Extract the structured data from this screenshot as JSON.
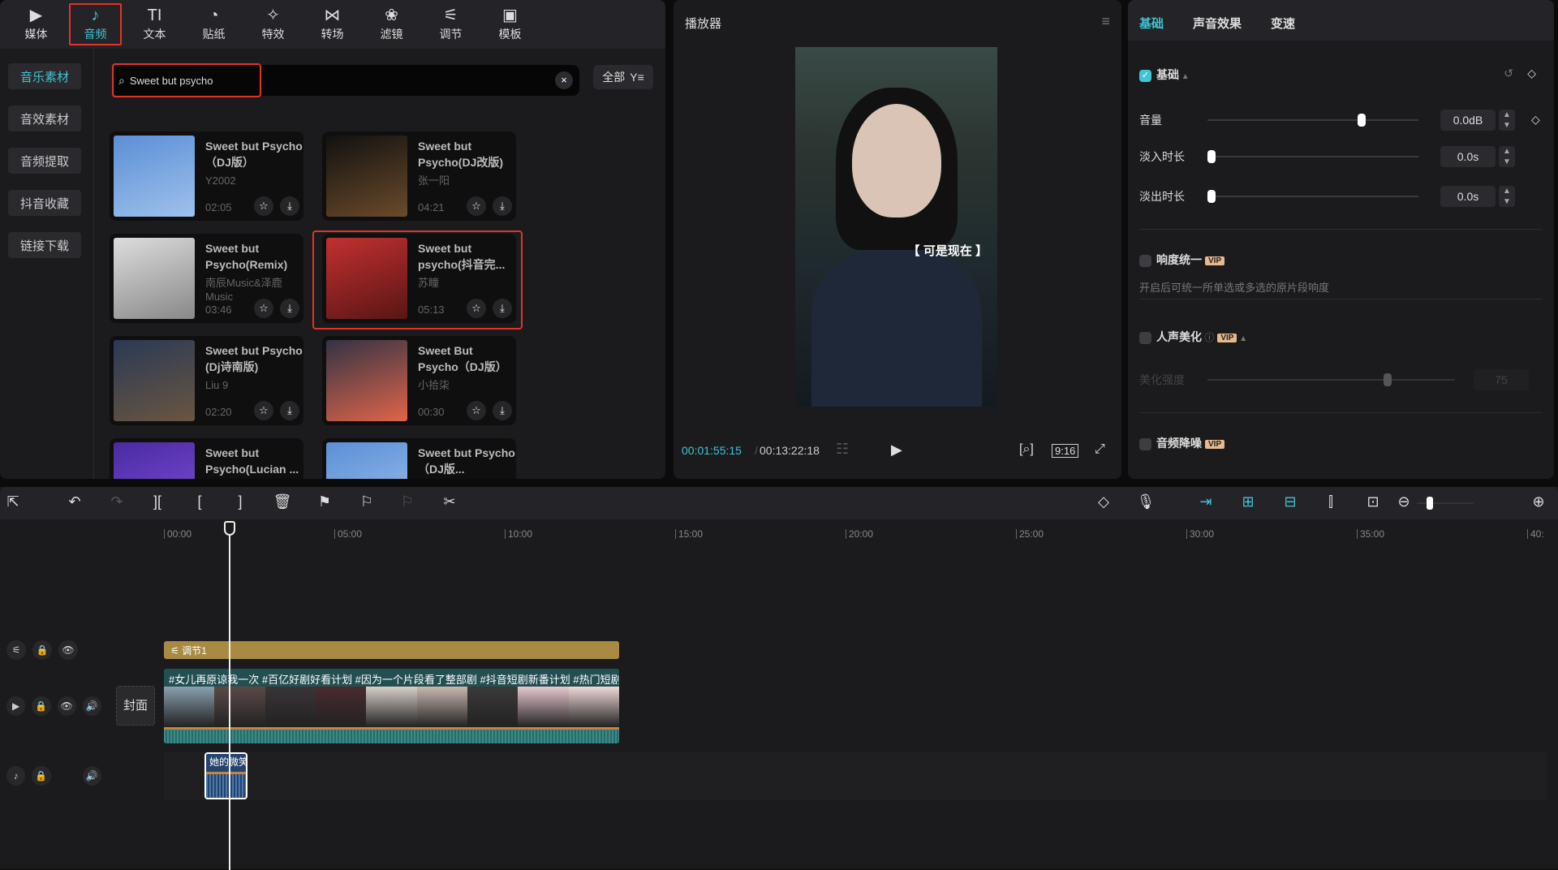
{
  "nav": {
    "items": [
      {
        "icon": "media-icon",
        "glyph": "▶",
        "label": "媒体"
      },
      {
        "icon": "audio-icon",
        "glyph": "♪",
        "label": "音频",
        "active": true
      },
      {
        "icon": "text-icon",
        "glyph": "TI",
        "label": "文本"
      },
      {
        "icon": "sticker-icon",
        "glyph": "◔",
        "label": "贴纸"
      },
      {
        "icon": "effects-icon",
        "glyph": "✧",
        "label": "特效"
      },
      {
        "icon": "transition-icon",
        "glyph": "⋈",
        "label": "转场"
      },
      {
        "icon": "filter-icon",
        "glyph": "❀",
        "label": "滤镜"
      },
      {
        "icon": "adjust-icon",
        "glyph": "⚟",
        "label": "调节"
      },
      {
        "icon": "template-icon",
        "glyph": "▣",
        "label": "模板"
      }
    ]
  },
  "sidebar": {
    "items": [
      {
        "label": "音乐素材",
        "active": true
      },
      {
        "label": "音效素材"
      },
      {
        "label": "音频提取"
      },
      {
        "label": "抖音收藏"
      },
      {
        "label": "链接下载"
      }
    ]
  },
  "search": {
    "value": "Sweet but psycho",
    "clear": "×",
    "filter_label": "全部",
    "filter_icon": "Y≡"
  },
  "songs": [
    {
      "title": "Sweet but Psycho（DJ版）",
      "artist": "Y2002",
      "duration": "02:05",
      "thumb": [
        "#5b8fd6",
        "#9fc1ec"
      ]
    },
    {
      "title": "Sweet but Psycho(DJ改版)",
      "artist": "张一阳",
      "duration": "04:21",
      "thumb": [
        "#111",
        "#6b4a2a"
      ]
    },
    {
      "title": "Sweet but Psycho(Remix)",
      "artist": "南辰Music&泽鹿Music",
      "duration": "03:46",
      "thumb": [
        "#ddd",
        "#888"
      ]
    },
    {
      "title": "Sweet but psycho(抖音完...",
      "artist": "苏瞳",
      "duration": "05:13",
      "thumb": [
        "#c23030",
        "#5a1515"
      ],
      "selected": true
    },
    {
      "title": "Sweet but Psycho (Dj诗南版)",
      "artist": "Liu 9",
      "duration": "02:20",
      "thumb": [
        "#2a3a55",
        "#6a5540"
      ]
    },
    {
      "title": "Sweet But Psycho（DJ版）",
      "artist": "小拾柒",
      "duration": "00:30",
      "thumb": [
        "#334",
        "#e0644a"
      ]
    },
    {
      "title": "Sweet but Psycho(Lucian ...",
      "artist": "",
      "duration": "",
      "thumb": [
        "#4a2aa0",
        "#8050e0"
      ]
    },
    {
      "title": "Sweet but Psycho（DJ版...",
      "artist": "",
      "duration": "",
      "thumb": [
        "#5b8fd6",
        "#9fc1ec"
      ]
    }
  ],
  "player": {
    "title": "播放器",
    "subtitle": "【 可是现在 】",
    "current_time": "00:01:55:15",
    "total_time": "00:13:22:18",
    "ratio": "9:16"
  },
  "inspector": {
    "tabs": [
      "基础",
      "声音效果",
      "变速"
    ],
    "section": "基础",
    "volume": {
      "label": "音量",
      "value": "0.0dB",
      "level": 0.74
    },
    "fade_in": {
      "label": "淡入时长",
      "value": "0.0s"
    },
    "fade_out": {
      "label": "淡出时长",
      "value": "0.0s"
    },
    "loudness": {
      "label": "响度统一",
      "desc": "开启后可统一所单选或多选的原片段响度"
    },
    "voice": {
      "label": "人声美化",
      "strength_label": "美化强度",
      "strength": "75"
    },
    "denoise": {
      "label": "音频降噪"
    },
    "vip": "VIP"
  },
  "timeline": {
    "ruler": [
      "00:00",
      "05:00",
      "10:00",
      "15:00",
      "20:00",
      "25:00",
      "30:00",
      "35:00",
      "40:"
    ],
    "adjust_clip": "调节1",
    "video_caption": "#女儿再原谅我一次 #百亿好剧好看计划 #因为一个片段看了整部剧 #抖音短剧新番计划 #热门短剧",
    "cover": "封面",
    "audio_clip": "她的微笑"
  },
  "colors": {
    "accent": "#3fc5d3",
    "highlight": "#e0342b",
    "adjust_clip": "#a88a42",
    "video_track": "#2a6a6a"
  }
}
